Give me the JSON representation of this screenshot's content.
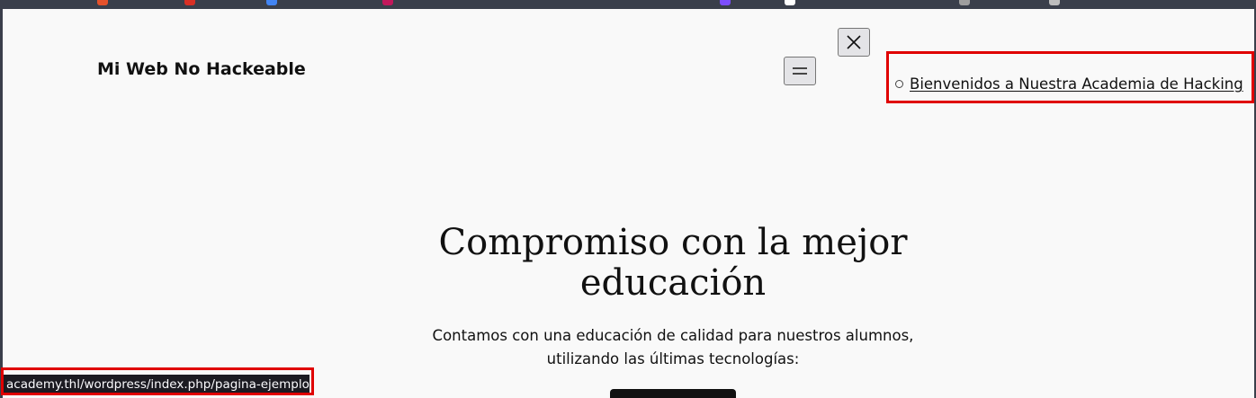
{
  "site": {
    "title": "Mi Web No Hackeable"
  },
  "nav": {
    "menu_toggle_icon": "hamburger-icon",
    "close_icon": "close-icon",
    "items": [
      {
        "label": "Bienvenidos a Nuestra Academia de Hacking"
      }
    ]
  },
  "hero": {
    "heading_line1": "Compromiso con la mejor",
    "heading_line2": "educación",
    "text_line1": "Contamos con una educación de calidad para nuestros alumnos,",
    "text_line2": "utilizando las últimas tecnologías:"
  },
  "status_bar": {
    "url": "academy.thl/wordpress/index.php/pagina-ejemplo/"
  },
  "colors": {
    "highlight": "#e00000",
    "page_background": "#f9f9f9",
    "browser_chrome": "#3a3f4b",
    "status_background": "#1c1b22"
  }
}
